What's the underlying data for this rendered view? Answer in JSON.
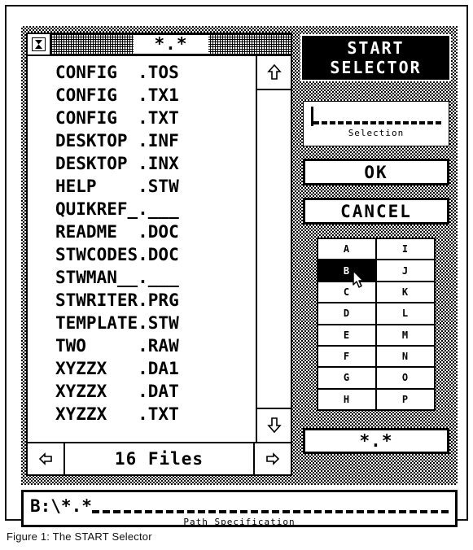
{
  "caption": "Figure 1: The START Selector",
  "window": {
    "title": "*.*",
    "close_box_icon": "close-box-icon",
    "files": [
      "CONFIG  .TOS",
      "CONFIG  .TX1",
      "CONFIG  .TXT",
      "DESKTOP .INF",
      "DESKTOP .INX",
      "HELP    .STW",
      "QUIKREF_.___",
      "README  .DOC",
      "STWCODES.DOC",
      "STWMAN__.___",
      "STWRITER.PRG",
      "TEMPLATE.STW",
      "TWO     .RAW",
      "XYZZX   .DA1",
      "XYZZX   .DAT",
      "XYZZX   .TXT"
    ],
    "scroll_up_icon": "arrow-up-icon",
    "scroll_down_icon": "arrow-down-icon",
    "page_left_icon": "arrow-left-icon",
    "page_right_icon": "arrow-right-icon",
    "file_count": "16 Files"
  },
  "panel": {
    "title_line1": "START",
    "title_line2": "SELECTOR",
    "selection_value": "",
    "selection_label": "Selection",
    "ok_label": "OK",
    "cancel_label": "CANCEL",
    "mask_value": "*.*",
    "drives": [
      {
        "label": "A",
        "selected": false
      },
      {
        "label": "I",
        "selected": false
      },
      {
        "label": "B",
        "selected": true
      },
      {
        "label": "J",
        "selected": false
      },
      {
        "label": "C",
        "selected": false
      },
      {
        "label": "K",
        "selected": false
      },
      {
        "label": "D",
        "selected": false
      },
      {
        "label": "L",
        "selected": false
      },
      {
        "label": "E",
        "selected": false
      },
      {
        "label": "M",
        "selected": false
      },
      {
        "label": "F",
        "selected": false
      },
      {
        "label": "N",
        "selected": false
      },
      {
        "label": "G",
        "selected": false
      },
      {
        "label": "O",
        "selected": false
      },
      {
        "label": "H",
        "selected": false
      },
      {
        "label": "P",
        "selected": false
      }
    ]
  },
  "path": {
    "value": "B:\\*.*",
    "label": "Path Specification"
  },
  "colors": {
    "ink": "#000000",
    "paper": "#ffffff"
  }
}
